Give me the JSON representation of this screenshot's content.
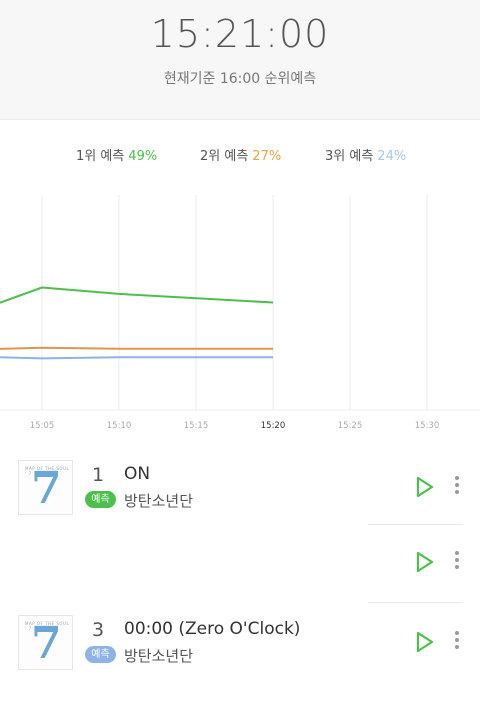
{
  "header": {
    "time": "15:21:00",
    "subtitle": "현재기준 16:00 순위예측"
  },
  "legend": [
    {
      "label": "1위 예측",
      "pct": "49%",
      "color": "#4cc04c"
    },
    {
      "label": "2위 예측",
      "pct": "27%",
      "color": "#f0a04b"
    },
    {
      "label": "3위 예측",
      "pct": "24%",
      "color": "#a9c6ec"
    }
  ],
  "chart_data": {
    "type": "line",
    "x": [
      "15:05",
      "15:10",
      "15:15",
      "15:20",
      "15:25",
      "15:30"
    ],
    "highlight_x": "15:20",
    "ylim": [
      0,
      100
    ],
    "grid": "vertical",
    "series": [
      {
        "color": "#4cc04c",
        "points": [
          [
            "15:00",
            44
          ],
          [
            "15:05",
            57
          ],
          [
            "15:10",
            54
          ],
          [
            "15:20",
            50
          ]
        ]
      },
      {
        "color": "#e0964a",
        "points": [
          [
            "15:00",
            28
          ],
          [
            "15:05",
            29
          ],
          [
            "15:10",
            28.5
          ],
          [
            "15:20",
            28.5
          ]
        ]
      },
      {
        "color": "#8fb3e6",
        "points": [
          [
            "15:00",
            25
          ],
          [
            "15:05",
            24
          ],
          [
            "15:10",
            24.5
          ],
          [
            "15:20",
            24.5
          ]
        ]
      }
    ]
  },
  "songs": [
    {
      "rank": "1",
      "title": "ON",
      "badge": "예측",
      "badge_color": "#4cc04c",
      "artist": "방탄소년단",
      "album_text": "MAP OF THE SOUL : 7",
      "album_number": "7"
    },
    {
      "rank": "",
      "title": "",
      "badge": "",
      "artist": ""
    },
    {
      "rank": "3",
      "title": "00:00 (Zero O'Clock)",
      "badge": "예측",
      "badge_color": "#8fb3e6",
      "artist": "방탄소년단",
      "album_text": "MAP OF THE SOUL : 7",
      "album_number": "7"
    }
  ],
  "icons": {
    "play": "play-icon",
    "more": "more-vertical-icon",
    "play_color": "#4cc04c"
  }
}
